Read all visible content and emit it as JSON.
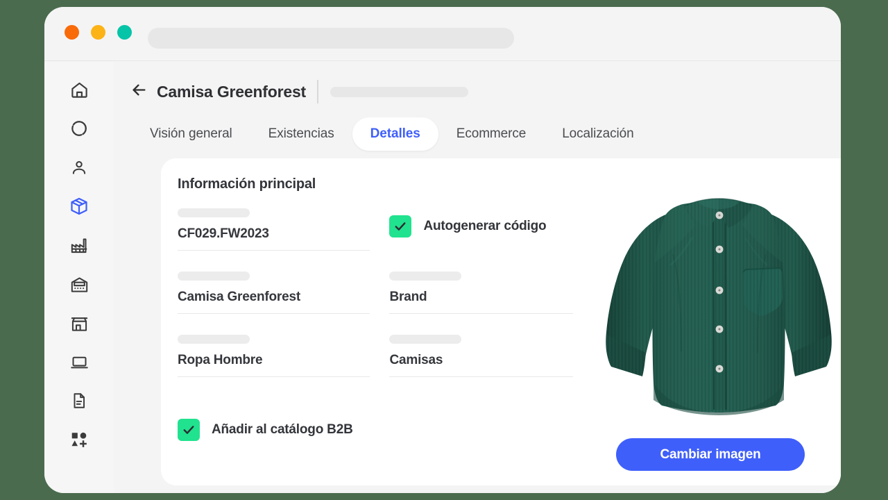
{
  "window": {
    "traffic_lights": [
      {
        "name": "close",
        "color": "#f96a08"
      },
      {
        "name": "minimize",
        "color": "#fcb316"
      },
      {
        "name": "maximize",
        "color": "#06c4a8"
      }
    ],
    "url_value": "",
    "background_color": "#4b6b4e"
  },
  "sidebar": {
    "items": [
      {
        "icon": "home-icon",
        "label": "Inicio",
        "active": false
      },
      {
        "icon": "dashboard-donut-icon",
        "label": "Panel",
        "active": false
      },
      {
        "icon": "user-icon",
        "label": "Contactos",
        "active": false
      },
      {
        "icon": "box-package-icon",
        "label": "Productos",
        "active": true
      },
      {
        "icon": "factory-icon",
        "label": "Fabricación",
        "active": false
      },
      {
        "icon": "warehouse-icon",
        "label": "Almacén",
        "active": false
      },
      {
        "icon": "store-icon",
        "label": "Tienda",
        "active": false
      },
      {
        "icon": "laptop-icon",
        "label": "Punto de venta",
        "active": false
      },
      {
        "icon": "document-icon",
        "label": "Documentos",
        "active": false
      },
      {
        "icon": "shapes-add-icon",
        "label": "Más aplicaciones",
        "active": false
      }
    ]
  },
  "header": {
    "back_icon": "arrow-left-icon",
    "title": "Camisa Greenforest",
    "skeleton": ""
  },
  "tabs": [
    {
      "label": "Visión general",
      "active": false
    },
    {
      "label": "Existencias",
      "active": false
    },
    {
      "label": "Detalles",
      "active": true
    },
    {
      "label": "Ecommerce",
      "active": false
    },
    {
      "label": "Localización",
      "active": false
    }
  ],
  "card": {
    "title": "Información principal",
    "fields": [
      {
        "name": "reference-code",
        "label": "",
        "value": "CF029.FW2023"
      },
      {
        "name": "product-name",
        "label": "",
        "value": "Camisa Greenforest"
      },
      {
        "name": "brand",
        "label": "",
        "value": "Brand"
      },
      {
        "name": "category",
        "label": "",
        "value": "Ropa Hombre"
      },
      {
        "name": "subcategory",
        "label": "",
        "value": "Camisas"
      }
    ],
    "checkbox_autogenerate": {
      "label": "Autogenerar código",
      "checked": true,
      "color": "#21e28e"
    },
    "checkbox_b2b": {
      "label": "Añadir al catálogo B2B",
      "checked": true,
      "color": "#21e28e"
    },
    "product_image": {
      "alt": "Camisa de pana verde bosque",
      "color": "#22604f"
    },
    "change_image_button": {
      "label": "Cambiar imagen",
      "color": "#3f5ffb"
    }
  },
  "colors": {
    "accent_blue": "#3f5ffb",
    "accent_green": "#21e28e",
    "page_background": "#4b6b4e",
    "shirt_green": "#22604f"
  }
}
